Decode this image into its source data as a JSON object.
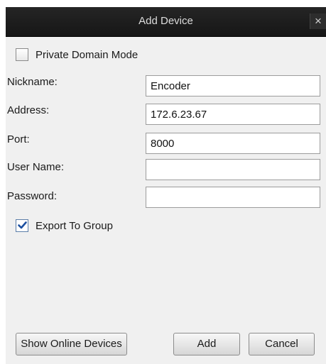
{
  "dialog": {
    "title": "Add Device",
    "close_glyph": "×"
  },
  "private_domain": {
    "label": "Private Domain Mode",
    "checked": false
  },
  "fields": {
    "nickname": {
      "label": "Nickname:",
      "value": "Encoder"
    },
    "address": {
      "label": "Address:",
      "value": "172.6.23.67"
    },
    "port": {
      "label": "Port:",
      "value": "8000"
    },
    "username": {
      "label": "User Name:",
      "value": ""
    },
    "password": {
      "label": "Password:",
      "value": ""
    }
  },
  "export_group": {
    "label": "Export To Group",
    "checked": true
  },
  "buttons": {
    "show_online": "Show Online Devices",
    "add": "Add",
    "cancel": "Cancel"
  },
  "icons": {
    "close": "close-icon",
    "check": "checkmark-icon"
  },
  "colors": {
    "titlebar": "#1c1c1c",
    "dialog_bg": "#f0f0f0",
    "check_blue": "#1b4fa0"
  }
}
